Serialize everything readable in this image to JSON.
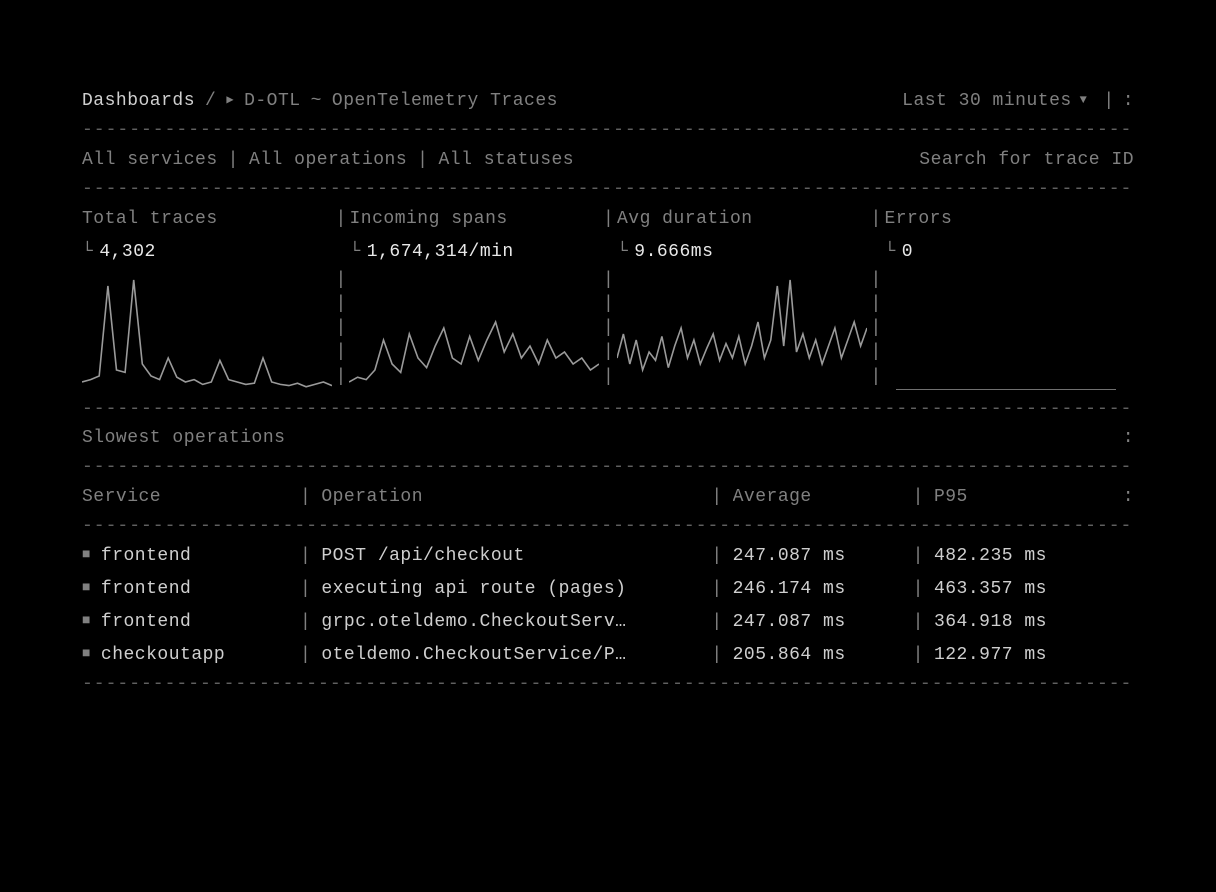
{
  "breadcrumb": {
    "root": "Dashboards",
    "sep1": "/",
    "play": "▶",
    "code": "D-OTL",
    "tilde": "~",
    "title": "OpenTelemetry Traces"
  },
  "time_range": {
    "label": "Last 30 minutes",
    "caret": "▼"
  },
  "menu_icon": ":",
  "pipe": "|",
  "filters": {
    "services": "All services",
    "operations": "All operations",
    "statuses": "All statuses",
    "search_placeholder": "Search for trace ID"
  },
  "metrics": [
    {
      "label": "Total traces",
      "value": "4,302"
    },
    {
      "label": "Incoming spans",
      "value": "1,674,314/min"
    },
    {
      "label": "Avg duration",
      "value": "9.666ms"
    },
    {
      "label": "Errors",
      "value": "0"
    }
  ],
  "corner_glyph": "└",
  "section": {
    "title": "Slowest operations"
  },
  "table": {
    "headers": {
      "service": "Service",
      "operation": "Operation",
      "average": "Average",
      "p95": "P95"
    },
    "rows": [
      {
        "service": "frontend",
        "operation": "POST /api/checkout",
        "average": "247.087 ms",
        "p95": "482.235 ms"
      },
      {
        "service": "frontend",
        "operation": "executing api route (pages)",
        "average": "246.174 ms",
        "p95": "463.357 ms"
      },
      {
        "service": "frontend",
        "operation": "grpc.oteldemo.CheckoutServ…",
        "average": "247.087 ms",
        "p95": "364.918 ms"
      },
      {
        "service": "checkoutapp",
        "operation": "oteldemo.CheckoutService/P…",
        "average": "205.864 ms",
        "p95": "122.977 ms"
      }
    ]
  },
  "chart_data": [
    {
      "type": "line",
      "title": "Total traces",
      "x": [
        0,
        1,
        2,
        3,
        4,
        5,
        6,
        7,
        8,
        9,
        10,
        11,
        12,
        13,
        14,
        15,
        16,
        17,
        18,
        19,
        20,
        21,
        22,
        23,
        24,
        25,
        26,
        27,
        28,
        29
      ],
      "values": [
        10,
        12,
        15,
        90,
        20,
        18,
        95,
        25,
        15,
        12,
        30,
        14,
        10,
        12,
        8,
        10,
        28,
        12,
        10,
        8,
        9,
        30,
        10,
        8,
        7,
        9,
        6,
        8,
        10,
        7
      ],
      "ylim": [
        0,
        100
      ]
    },
    {
      "type": "line",
      "title": "Incoming spans",
      "x": [
        0,
        1,
        2,
        3,
        4,
        5,
        6,
        7,
        8,
        9,
        10,
        11,
        12,
        13,
        14,
        15,
        16,
        17,
        18,
        19,
        20,
        21,
        22,
        23,
        24,
        25,
        26,
        27,
        28,
        29
      ],
      "values": [
        10,
        14,
        12,
        20,
        45,
        25,
        18,
        50,
        30,
        22,
        40,
        55,
        30,
        25,
        48,
        28,
        45,
        60,
        35,
        50,
        30,
        40,
        25,
        45,
        30,
        35,
        25,
        30,
        20,
        25
      ],
      "ylim": [
        0,
        100
      ]
    },
    {
      "type": "line",
      "title": "Avg duration",
      "x": [
        0,
        1,
        2,
        3,
        4,
        5,
        6,
        7,
        8,
        9,
        10,
        11,
        12,
        13,
        14,
        15,
        16,
        17,
        18,
        19,
        20,
        21,
        22,
        23,
        24,
        25,
        26,
        27,
        28,
        29,
        30,
        31,
        32,
        33,
        34,
        35,
        36,
        37,
        38,
        39
      ],
      "values": [
        30,
        50,
        25,
        45,
        20,
        35,
        28,
        48,
        22,
        40,
        55,
        30,
        45,
        25,
        38,
        50,
        28,
        42,
        30,
        48,
        25,
        40,
        60,
        30,
        45,
        90,
        40,
        95,
        35,
        50,
        30,
        45,
        25,
        40,
        55,
        30,
        45,
        60,
        40,
        55
      ],
      "ylim": [
        0,
        100
      ]
    },
    {
      "type": "line",
      "title": "Errors",
      "x": [
        0,
        1
      ],
      "values": [
        0,
        0
      ],
      "ylim": [
        0,
        100
      ]
    }
  ],
  "dash_line": "-----------------------------------------------------------------------------------------------"
}
